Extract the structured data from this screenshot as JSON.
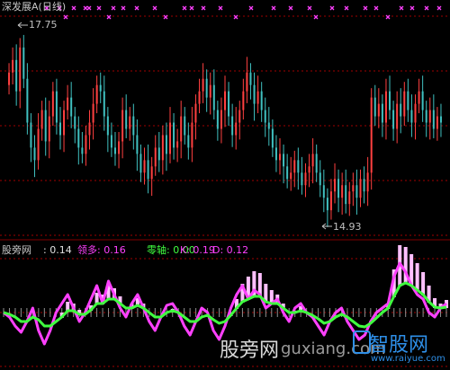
{
  "title": "深发展A(日线)",
  "price_panel": {
    "high_label": "17.75",
    "low_label": "14.93"
  },
  "indicator_header": {
    "name": "股旁网",
    "value": ": 0.14",
    "lead_label": "领多: 0.16",
    "zero_label": "零轴: 0.00",
    "k_label": "K: 0.19",
    "d_label": "D: 0.12"
  },
  "watermark": {
    "cn": "股旁网",
    "url": "guxiang.com",
    "brand": "智股网",
    "brand_url": "www.raiyue.com"
  },
  "colors": {
    "up": "#ff4040",
    "down": "#40c0c0",
    "grid": "#a00000",
    "marker": "#ff40ff",
    "k_line": "#ff40ff",
    "d_line": "#40ff40",
    "bar": "#ffffff"
  },
  "chart_data": [
    {
      "type": "candlestick",
      "title": "深发展A(日线)",
      "ylim": [
        14.6,
        18.1
      ],
      "high": 17.75,
      "low": 14.93,
      "closes": [
        17.2,
        17.4,
        16.9,
        17.6,
        17.1,
        16.4,
        16.0,
        15.8,
        16.3,
        16.6,
        16.1,
        16.5,
        16.9,
        16.4,
        16.2,
        16.6,
        16.8,
        16.5,
        16.3,
        16.0,
        15.9,
        16.2,
        16.4,
        16.7,
        17.0,
        16.9,
        16.5,
        16.2,
        16.0,
        15.9,
        16.1,
        16.6,
        16.3,
        16.5,
        16.2,
        15.9,
        15.6,
        15.8,
        15.5,
        15.7,
        16.0,
        15.8,
        16.2,
        15.9,
        16.4,
        16.0,
        16.1,
        16.5,
        16.2,
        16.0,
        16.4,
        16.7,
        16.9,
        17.1,
        16.8,
        17.0,
        16.6,
        16.3,
        16.6,
        16.9,
        16.5,
        16.2,
        16.4,
        16.6,
        16.9,
        17.2,
        17.0,
        16.7,
        16.9,
        16.6,
        16.4,
        16.3,
        16.0,
        15.8,
        15.9,
        15.7,
        15.5,
        15.6,
        15.8,
        15.6,
        15.4,
        15.6,
        15.7,
        15.9,
        15.6,
        15.4,
        15.2,
        15.0,
        15.3,
        15.5,
        15.2,
        15.4,
        15.1,
        15.3,
        15.4,
        15.2,
        15.5,
        15.3,
        15.6,
        16.8,
        16.5,
        16.7,
        16.4,
        16.9,
        16.6,
        16.3,
        16.7,
        16.5,
        16.9,
        16.6,
        16.4,
        16.7,
        16.9,
        16.6,
        16.4,
        16.6,
        16.3,
        16.5,
        16.4
      ],
      "markers": "pink crosses along top row (purple marks)"
    },
    {
      "type": "line",
      "title": "股旁网",
      "ylim": [
        -0.6,
        0.6
      ],
      "series": [
        {
          "name": "领多",
          "values": [
            0.0,
            -0.05,
            -0.15,
            -0.22,
            -0.1,
            0.05,
            -0.2,
            -0.35,
            -0.2,
            0.0,
            0.1,
            0.2,
            0.05,
            -0.1,
            0.0,
            0.15,
            0.3,
            0.1,
            0.35,
            0.2,
            0.05,
            -0.05,
            0.1,
            0.2,
            0.05,
            -0.1,
            -0.2,
            -0.05,
            0.08,
            0.1,
            0.0,
            -0.15,
            -0.25,
            -0.1,
            0.05,
            0.0,
            -0.2,
            -0.3,
            -0.15,
            0.05,
            0.2,
            0.3,
            0.15,
            0.25,
            0.2,
            0.05,
            0.1,
            0.15,
            0.0,
            -0.1,
            0.05,
            0.1,
            0.0,
            -0.05,
            -0.15,
            -0.25,
            -0.1,
            0.0,
            0.05,
            -0.1,
            -0.2,
            -0.3,
            -0.25,
            -0.1,
            0.0,
            0.05,
            0.1,
            0.4,
            0.55,
            0.45,
            0.3,
            0.2,
            0.15,
            0.0,
            -0.05,
            0.05,
            0.1
          ]
        },
        {
          "name": "零轴",
          "values": [
            0.0,
            -0.02,
            -0.05,
            -0.1,
            -0.1,
            -0.05,
            -0.08,
            -0.15,
            -0.15,
            -0.1,
            -0.05,
            0.02,
            0.02,
            -0.02,
            -0.02,
            0.03,
            0.1,
            0.1,
            0.15,
            0.15,
            0.1,
            0.05,
            0.05,
            0.08,
            0.05,
            0.0,
            -0.05,
            -0.05,
            0.0,
            0.02,
            0.0,
            -0.05,
            -0.1,
            -0.1,
            -0.05,
            -0.03,
            -0.08,
            -0.12,
            -0.1,
            -0.03,
            0.05,
            0.12,
            0.15,
            0.18,
            0.18,
            0.12,
            0.1,
            0.1,
            0.05,
            0.0,
            0.0,
            0.02,
            0.0,
            -0.03,
            -0.07,
            -0.12,
            -0.1,
            -0.05,
            -0.02,
            -0.05,
            -0.1,
            -0.15,
            -0.16,
            -0.12,
            -0.06,
            0.0,
            0.05,
            0.18,
            0.3,
            0.33,
            0.3,
            0.25,
            0.2,
            0.12,
            0.06,
            0.05,
            0.06
          ]
        }
      ],
      "bars": [
        0.0,
        0.0,
        0.0,
        0.0,
        0.0,
        0.0,
        0.0,
        0.0,
        0.0,
        0.0,
        0.05,
        0.1,
        0.08,
        0.05,
        0.0,
        0.05,
        0.12,
        0.1,
        0.15,
        0.12,
        0.08,
        0.0,
        0.05,
        0.08,
        0.05,
        0.0,
        0.0,
        0.0,
        0.0,
        0.02,
        0.0,
        0.0,
        0.0,
        0.0,
        0.0,
        0.0,
        0.0,
        0.0,
        0.0,
        0.03,
        0.1,
        0.2,
        0.25,
        0.28,
        0.26,
        0.2,
        0.15,
        0.1,
        0.05,
        0.0,
        0.02,
        0.05,
        0.0,
        0.0,
        0.0,
        0.0,
        0.0,
        0.0,
        0.0,
        0.0,
        0.0,
        0.0,
        0.0,
        0.0,
        0.0,
        0.0,
        0.05,
        0.3,
        0.45,
        0.4,
        0.35,
        0.3,
        0.25,
        0.18,
        0.1,
        0.05,
        0.08
      ]
    }
  ]
}
